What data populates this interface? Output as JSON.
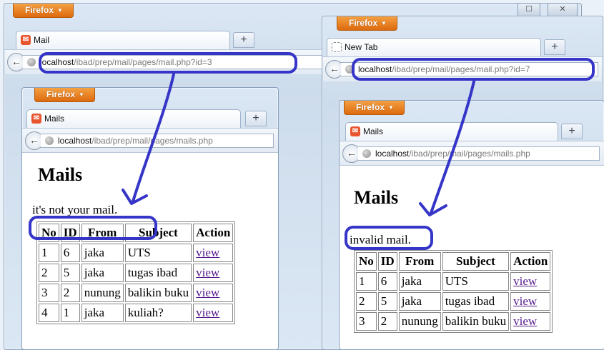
{
  "firefox_button_label": "Firefox",
  "left": {
    "outer": {
      "tab_label": "Mail",
      "url_host": "localhost",
      "url_path": "/ibad/prep/mail/pages/mail.php?id=3"
    },
    "inner": {
      "tab_label": "Mails",
      "url_host": "localhost",
      "url_path": "/ibad/prep/mail/pages/mails.php",
      "heading": "Mails",
      "message": "it's not your mail.",
      "table": {
        "headers": [
          "No",
          "ID",
          "From",
          "Subject",
          "Action"
        ],
        "rows": [
          {
            "no": "1",
            "id": "6",
            "from": "jaka",
            "subject": "UTS",
            "action": "view"
          },
          {
            "no": "2",
            "id": "5",
            "from": "jaka",
            "subject": "tugas ibad",
            "action": "view"
          },
          {
            "no": "3",
            "id": "2",
            "from": "nunung",
            "subject": "balikin buku",
            "action": "view"
          },
          {
            "no": "4",
            "id": "1",
            "from": "jaka",
            "subject": "kuliah?",
            "action": "view"
          }
        ]
      }
    }
  },
  "right": {
    "outer": {
      "tab_label": "New Tab",
      "url_host": "localhost",
      "url_path": "/ibad/prep/mail/pages/mail.php?id=7"
    },
    "inner": {
      "tab_label": "Mails",
      "url_host": "localhost",
      "url_path": "/ibad/prep/mail/pages/mails.php",
      "heading": "Mails",
      "message": "invalid mail.",
      "table": {
        "headers": [
          "No",
          "ID",
          "From",
          "Subject",
          "Action"
        ],
        "rows": [
          {
            "no": "1",
            "id": "6",
            "from": "jaka",
            "subject": "UTS",
            "action": "view"
          },
          {
            "no": "2",
            "id": "5",
            "from": "jaka",
            "subject": "tugas ibad",
            "action": "view"
          },
          {
            "no": "3",
            "id": "2",
            "from": "nunung",
            "subject": "balikin buku",
            "action": "view"
          }
        ]
      }
    }
  },
  "window_controls": {
    "minimize": "—",
    "maximize": "☐",
    "close": "✕"
  },
  "new_tab_symbol": "+",
  "back_symbol": "←",
  "favicon_symbol": "✉",
  "annotation_color": "#3535c8",
  "firefox_orange": "#e8781e"
}
